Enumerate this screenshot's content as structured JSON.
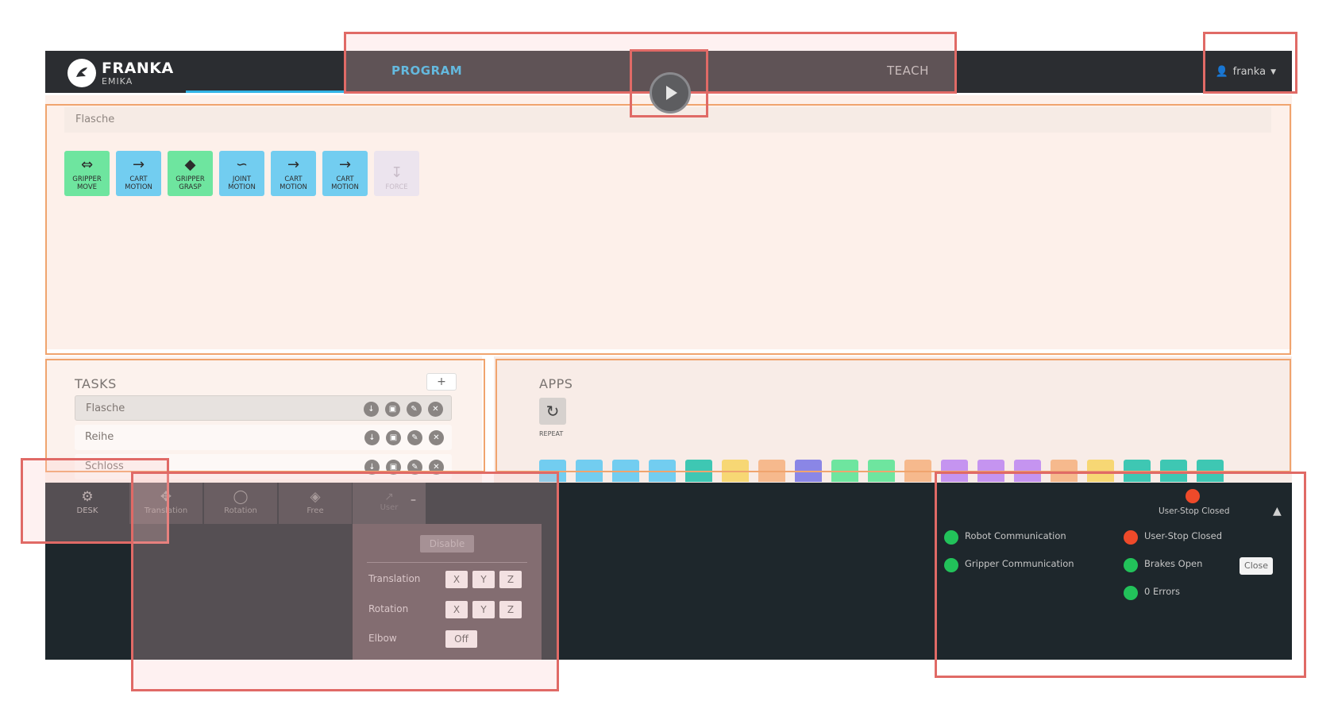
{
  "header": {
    "brand": "FRANKA",
    "brand_sub": "EMIKA",
    "tab_program": "PROGRAM",
    "tab_teach": "TEACH",
    "user_name": "franka"
  },
  "timeline": {
    "task_name": "Flasche",
    "skills": [
      {
        "line1": "GRIPPER",
        "line2": "MOVE",
        "color": "green",
        "icon": "gripper-move-icon"
      },
      {
        "line1": "CART",
        "line2": "MOTION",
        "color": "blue",
        "icon": "cart-motion-icon"
      },
      {
        "line1": "GRIPPER",
        "line2": "GRASP",
        "color": "green",
        "icon": "gripper-grasp-icon"
      },
      {
        "line1": "JOINT",
        "line2": "MOTION",
        "color": "blue",
        "icon": "joint-motion-icon"
      },
      {
        "line1": "CART",
        "line2": "MOTION",
        "color": "blue",
        "icon": "cart-motion-icon"
      },
      {
        "line1": "CART",
        "line2": "MOTION",
        "color": "blue",
        "icon": "cart-motion-icon"
      },
      {
        "line1": "FORCE",
        "line2": "",
        "color": "ghost",
        "icon": "force-icon"
      }
    ]
  },
  "tasks": {
    "title": "TASKS",
    "add": "+",
    "items": [
      "Flasche",
      "Reihe",
      "Schloss"
    ]
  },
  "apps": {
    "title": "APPS",
    "repeat_label": "REPEAT"
  },
  "bottom": {
    "desk": "DESK",
    "translation": "Translation",
    "rotation": "Rotation",
    "free": "Free",
    "user": "User",
    "disable": "Disable",
    "guide_translation": "Translation",
    "guide_rotation": "Rotation",
    "guide_elbow": "Elbow",
    "x": "X",
    "y": "Y",
    "z": "Z",
    "elbow_value": "Off"
  },
  "status": {
    "header_label": "User-Stop Closed",
    "robot_comm": "Robot Communication",
    "gripper_comm": "Gripper Communication",
    "user_stop": "User-Stop Closed",
    "brakes": "Brakes Open",
    "errors": "0 Errors",
    "close": "Close"
  },
  "colors": {
    "accent": "#32b4e6",
    "annotation": "#e06a66",
    "status_ok": "#22c25a",
    "status_stop": "#ee4a2a"
  }
}
